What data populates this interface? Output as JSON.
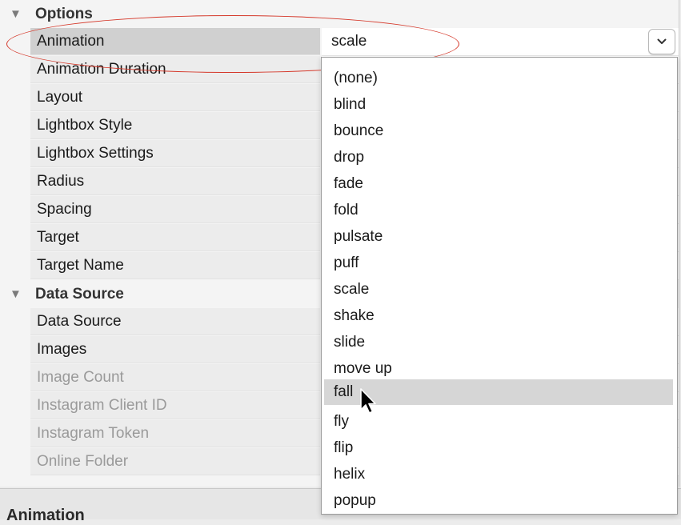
{
  "sections": {
    "options": "Options",
    "data_source": "Data Source"
  },
  "options_rows": [
    {
      "name": "Animation",
      "value": "scale"
    },
    {
      "name": "Animation Duration"
    },
    {
      "name": "Layout"
    },
    {
      "name": "Lightbox Style"
    },
    {
      "name": "Lightbox Settings"
    },
    {
      "name": "Radius"
    },
    {
      "name": "Spacing"
    },
    {
      "name": "Target"
    },
    {
      "name": "Target Name"
    }
  ],
  "data_source_rows": [
    {
      "name": "Data Source"
    },
    {
      "name": "Images"
    },
    {
      "name": "Image Count"
    },
    {
      "name": "Instagram Client ID"
    },
    {
      "name": "Instagram Token"
    },
    {
      "name": "Online Folder"
    }
  ],
  "dropdown": {
    "options": [
      "(none)",
      "blind",
      "bounce",
      "drop",
      "fade",
      "fold",
      "pulsate",
      "puff",
      "scale",
      "shake",
      "slide",
      "move up",
      "fall",
      "fly",
      "flip",
      "helix",
      "popup"
    ],
    "hovered": "fall"
  },
  "footer": {
    "label": "Animation"
  },
  "colors": {
    "highlight_oval": "#d5382a",
    "hover_bg": "#d6d6d6",
    "selected_row_bg": "#d0d0d0"
  },
  "icons": {
    "section_toggle": "triangle-down-icon",
    "dropdown": "chevron-down-icon",
    "cursor": "arrow-cursor-icon"
  }
}
